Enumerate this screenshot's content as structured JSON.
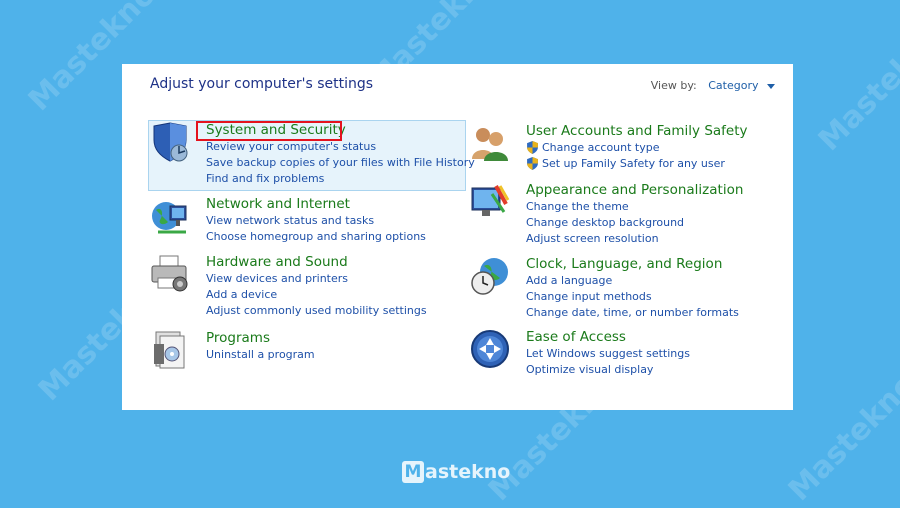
{
  "watermark": "Mastekno",
  "logo": {
    "mark": "M",
    "text": "astekno"
  },
  "header": {
    "title": "Adjust your computer's settings",
    "view_by_label": "View by:",
    "view_by_value": "Category"
  },
  "categories": [
    {
      "title": "System and Security",
      "icon": "shield-icon",
      "links": [
        {
          "text": "Review your computer's status"
        },
        {
          "text": "Save backup copies of your files with File History"
        },
        {
          "text": "Find and fix problems"
        }
      ]
    },
    {
      "title": "Network and Internet",
      "icon": "network-icon",
      "links": [
        {
          "text": "View network status and tasks"
        },
        {
          "text": "Choose homegroup and sharing options"
        }
      ]
    },
    {
      "title": "Hardware and Sound",
      "icon": "printer-icon",
      "links": [
        {
          "text": "View devices and printers"
        },
        {
          "text": "Add a device"
        },
        {
          "text": "Adjust commonly used mobility settings"
        }
      ]
    },
    {
      "title": "Programs",
      "icon": "programs-icon",
      "links": [
        {
          "text": "Uninstall a program"
        }
      ]
    },
    {
      "title": "User Accounts and Family Safety",
      "icon": "users-icon",
      "links": [
        {
          "text": "Change account type",
          "shield": true
        },
        {
          "text": "Set up Family Safety for any user",
          "shield": true
        }
      ]
    },
    {
      "title": "Appearance and Personalization",
      "icon": "appearance-icon",
      "links": [
        {
          "text": "Change the theme"
        },
        {
          "text": "Change desktop background"
        },
        {
          "text": "Adjust screen resolution"
        }
      ]
    },
    {
      "title": "Clock, Language, and Region",
      "icon": "clock-globe-icon",
      "links": [
        {
          "text": "Add a language"
        },
        {
          "text": "Change input methods"
        },
        {
          "text": "Change date, time, or number formats"
        }
      ]
    },
    {
      "title": "Ease of Access",
      "icon": "ease-of-access-icon",
      "links": [
        {
          "text": "Let Windows suggest settings"
        },
        {
          "text": "Optimize visual display"
        }
      ]
    }
  ]
}
